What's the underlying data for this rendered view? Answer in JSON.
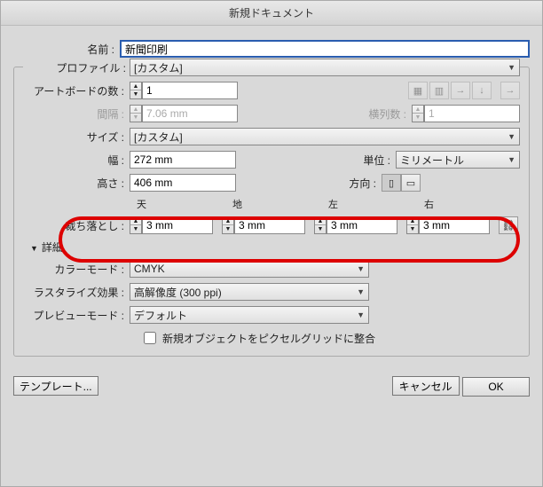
{
  "title": "新規ドキュメント",
  "labels": {
    "name": "名前 :",
    "profile": "プロファイル :",
    "artboards": "アートボードの数 :",
    "spacing": "間隔 :",
    "columns": "横列数 :",
    "size": "サイズ :",
    "width": "幅 :",
    "height": "高さ :",
    "units": "単位 :",
    "orient": "方向 :",
    "bleed": "裁ち落とし :",
    "details": "詳細",
    "colormode": "カラーモード :",
    "raster": "ラスタライズ効果 :",
    "preview": "プレビューモード :",
    "pixelgrid": "新規オブジェクトをピクセルグリッドに整合",
    "top": "天",
    "bottom": "地",
    "left": "左",
    "right": "右"
  },
  "values": {
    "name": "新聞印刷",
    "profile": "[カスタム]",
    "artboards": "1",
    "spacing": "7.06 mm",
    "columns": "1",
    "size": "[カスタム]",
    "width": "272 mm",
    "height": "406 mm",
    "units": "ミリメートル",
    "bleed_top": "3 mm",
    "bleed_bottom": "3 mm",
    "bleed_left": "3 mm",
    "bleed_right": "3 mm",
    "colormode": "CMYK",
    "raster": "高解像度 (300 ppi)",
    "preview": "デフォルト"
  },
  "buttons": {
    "template": "テンプレート...",
    "cancel": "キャンセル",
    "ok": "OK"
  }
}
